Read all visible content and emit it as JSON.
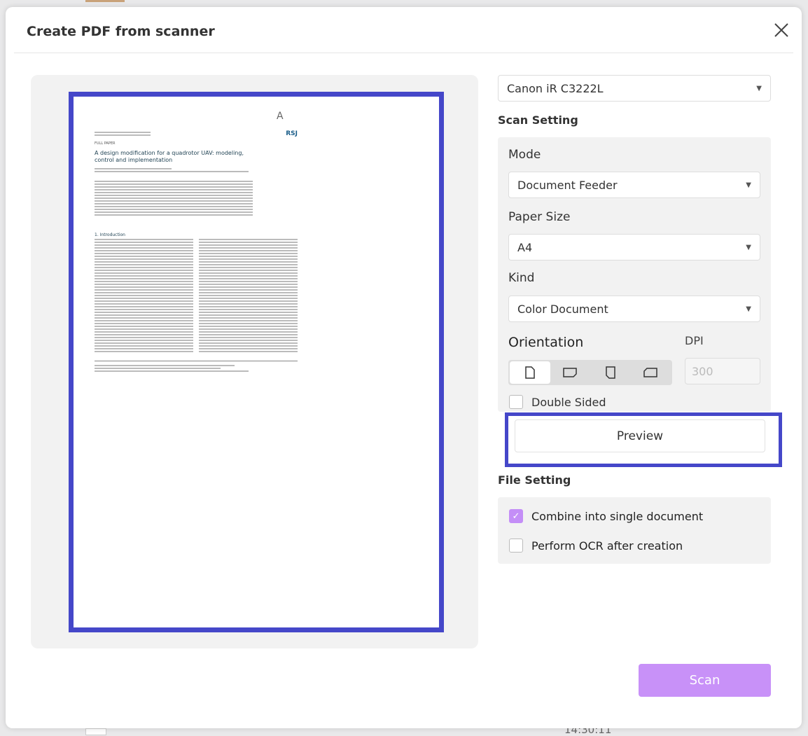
{
  "background": {
    "time": "14:30:11"
  },
  "dialog": {
    "title": "Create PDF from scanner"
  },
  "paper": {
    "journal": "RSJ",
    "type": "FULL PAPER",
    "title": "A design modification for a quadrotor UAV: modeling, control and implementation",
    "section": "1. Introduction"
  },
  "scanner": {
    "selected": "Canon iR C3222L"
  },
  "scan_setting": {
    "heading": "Scan Setting",
    "mode_label": "Mode",
    "mode": "Document Feeder",
    "paper_size_label": "Paper Size",
    "paper_size": "A4",
    "kind_label": "Kind",
    "kind": "Color Document",
    "orientation_label": "Orientation",
    "orientation_options": [
      "portrait",
      "landscape",
      "portrait-flipped",
      "landscape-flipped"
    ],
    "orientation_selected": "portrait",
    "dpi_label": "DPI",
    "dpi": "300",
    "double_sided_label": "Double Sided",
    "double_sided": false,
    "preview_label": "Preview"
  },
  "file_setting": {
    "heading": "File Setting",
    "combine_label": "Combine into single document",
    "combine": true,
    "ocr_label": "Perform OCR after creation",
    "ocr": false
  },
  "scan_label": "Scan",
  "colors": {
    "accent": "#c891f8",
    "highlight": "#4547c9"
  }
}
